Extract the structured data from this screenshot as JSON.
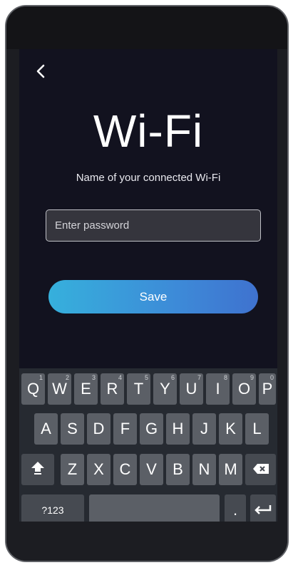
{
  "screen": {
    "title": "Wi-Fi",
    "subtitle": "Name of your connected Wi-Fi",
    "password_placeholder": "Enter password",
    "save_label": "Save"
  },
  "keyboard": {
    "row1": [
      {
        "label": "Q",
        "hint": "1"
      },
      {
        "label": "W",
        "hint": "2"
      },
      {
        "label": "E",
        "hint": "3"
      },
      {
        "label": "R",
        "hint": "4"
      },
      {
        "label": "T",
        "hint": "5"
      },
      {
        "label": "Y",
        "hint": "6"
      },
      {
        "label": "U",
        "hint": "7"
      },
      {
        "label": "I",
        "hint": "8"
      },
      {
        "label": "O",
        "hint": "9"
      },
      {
        "label": "P",
        "hint": "0"
      }
    ],
    "row2": [
      "A",
      "S",
      "D",
      "F",
      "G",
      "H",
      "J",
      "K",
      "L"
    ],
    "row3": [
      "Z",
      "X",
      "C",
      "V",
      "B",
      "N",
      "M"
    ],
    "symbols_label": "?123",
    "period_label": ".",
    "icons": [
      "shift-icon",
      "backspace-icon",
      "enter-icon"
    ]
  }
}
